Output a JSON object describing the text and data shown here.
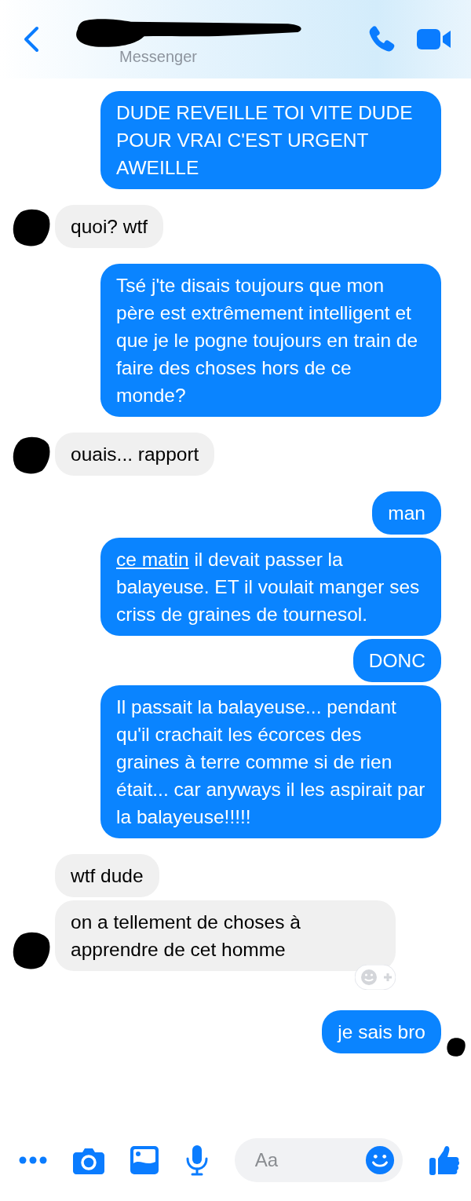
{
  "header": {
    "subtitle": "Messenger"
  },
  "messages": [
    {
      "kind": "me",
      "text": "DUDE REVEILLE TOI VITE DUDE POUR VRAI C'EST URGENT AWEILLE"
    },
    {
      "kind": "them",
      "text": "quoi? wtf",
      "avatar": true
    },
    {
      "kind": "me",
      "text": "Tsé j'te disais toujours que mon père est extrêmement intelligent et que je le pogne toujours en train de faire des choses hors de ce monde?"
    },
    {
      "kind": "them",
      "text": "ouais... rapport",
      "avatar": true
    },
    {
      "kind": "me",
      "text": "man"
    },
    {
      "kind": "me",
      "parts": [
        {
          "kind": "link",
          "text": "ce matin"
        },
        {
          "kind": "plain",
          "text": " il devait passer la balayeuse. ET il voulait manger ses criss de graines de tournesol."
        }
      ]
    },
    {
      "kind": "me",
      "text": "DONC"
    },
    {
      "kind": "me",
      "text": "Il passait la balayeuse... pendant qu'il crachait les écorces des graines à terre comme si de rien était... car anyways il les aspirait par la balayeuse!!!!!"
    },
    {
      "kind": "them",
      "text": "wtf dude"
    },
    {
      "kind": "them",
      "text": "on a tellement de choses à apprendre de cet homme",
      "avatar": true,
      "reaction_button": true
    },
    {
      "kind": "me",
      "text": "je sais bro",
      "avatar": true
    }
  ],
  "composer": {
    "placeholder": "Aa"
  }
}
